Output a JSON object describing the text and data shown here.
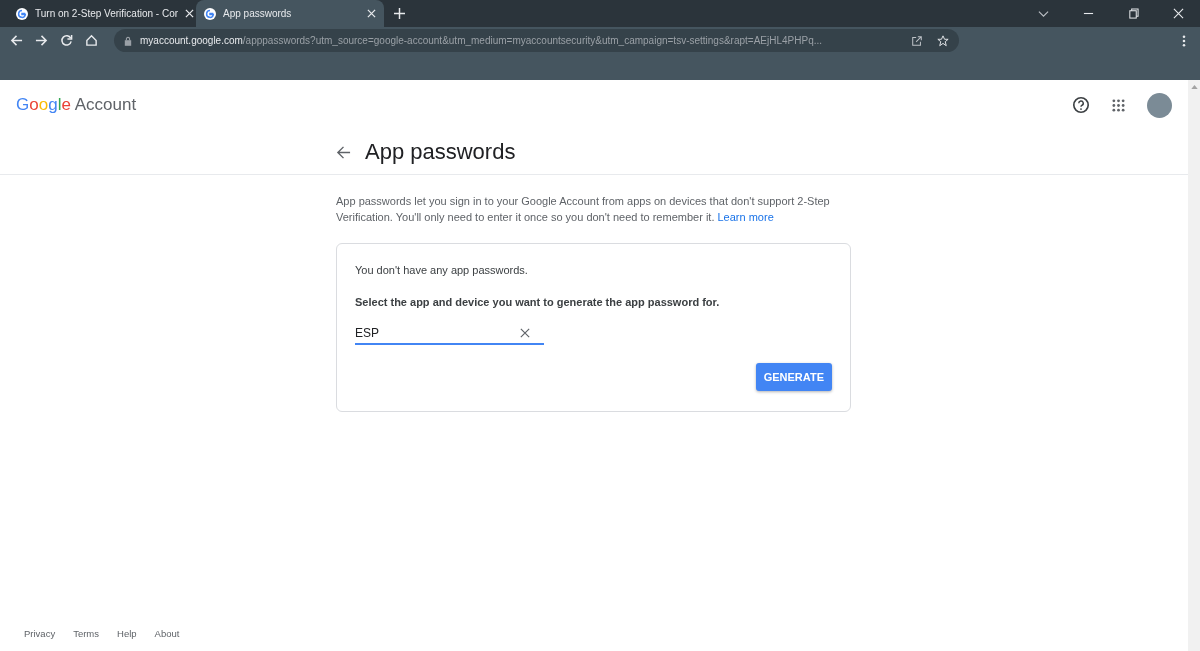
{
  "browser": {
    "tabs": [
      {
        "title": "Turn on 2-Step Verification - Cor",
        "selected": false
      },
      {
        "title": "App passwords",
        "selected": true
      }
    ],
    "url": {
      "host": "myaccount.google.com",
      "rest": "/apppasswords?utm_source=google-account&utm_medium=myaccountsecurity&utm_campaign=tsv-settings&rapt=AEjHL4PHPq..."
    }
  },
  "header": {
    "brand": "Google",
    "product": "Account"
  },
  "page": {
    "title": "App passwords",
    "intro": "App passwords let you sign in to your Google Account from apps on devices that don't support 2-Step Verification. You'll only need to enter it once so you don't need to remember it.",
    "learn_more": "Learn more",
    "card": {
      "empty_message": "You don't have any app passwords.",
      "instruction": "Select the app and device you want to generate the app password for.",
      "field_value": "ESP",
      "button": "GENERATE"
    }
  },
  "footer": [
    "Privacy",
    "Terms",
    "Help",
    "About"
  ]
}
